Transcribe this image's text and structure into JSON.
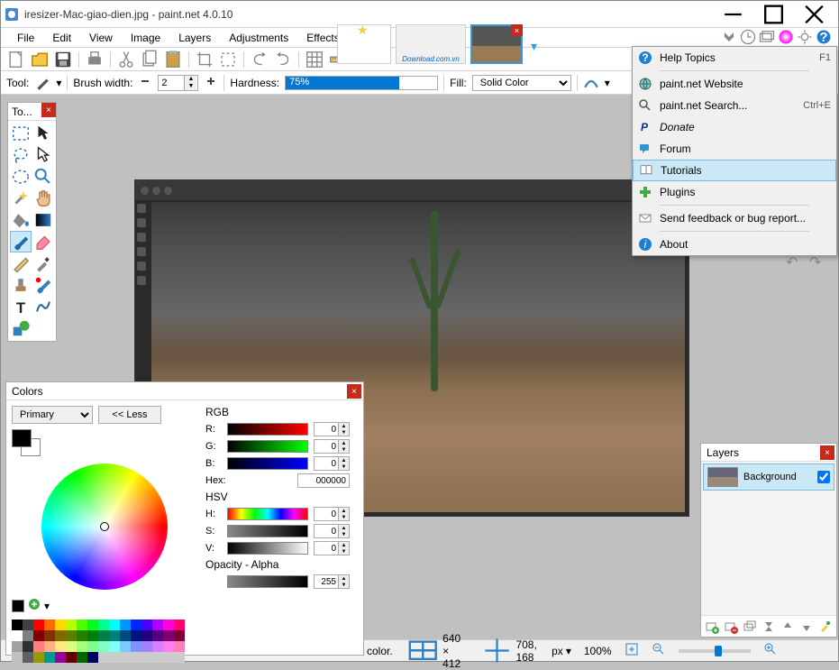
{
  "window": {
    "title": "iresizer-Mac-giao-dien.jpg - paint.net 4.0.10"
  },
  "menu": {
    "file": "File",
    "edit": "Edit",
    "view": "View",
    "image": "Image",
    "layers": "Layers",
    "adjustments": "Adjustments",
    "effects": "Effects"
  },
  "help_menu": {
    "help_topics": "Help Topics",
    "help_topics_key": "F1",
    "website": "paint.net Website",
    "search": "paint.net Search...",
    "search_key": "Ctrl+E",
    "donate": "Donate",
    "forum": "Forum",
    "tutorials": "Tutorials",
    "plugins": "Plugins",
    "feedback": "Send feedback or bug report...",
    "about": "About"
  },
  "options": {
    "tool_label": "Tool:",
    "brush_width_label": "Brush width:",
    "brush_width_value": "2",
    "hardness_label": "Hardness:",
    "hardness_value": "75%",
    "fill_label": "Fill:",
    "fill_value": "Solid Color"
  },
  "tools_panel": {
    "title": "To..."
  },
  "colors_panel": {
    "title": "Colors",
    "primary": "Primary",
    "less": "<< Less",
    "rgb": "RGB",
    "r": "R:",
    "g": "G:",
    "b": "B:",
    "hex_label": "Hex:",
    "hex_value": "000000",
    "hsv": "HSV",
    "h": "H:",
    "s": "S:",
    "v": "V:",
    "opacity_label": "Opacity - Alpha",
    "r_val": "0",
    "g_val": "0",
    "b_val": "0",
    "h_val": "0",
    "s_val": "0",
    "v_val": "0",
    "a_val": "255"
  },
  "layers_panel": {
    "title": "Layers",
    "background": "Background"
  },
  "status": {
    "color_text": "color.",
    "size": "640 × 412",
    "pos": "708, 168",
    "unit": "px",
    "zoom": "100%"
  },
  "thumb_watermark": "Download.com.vn"
}
